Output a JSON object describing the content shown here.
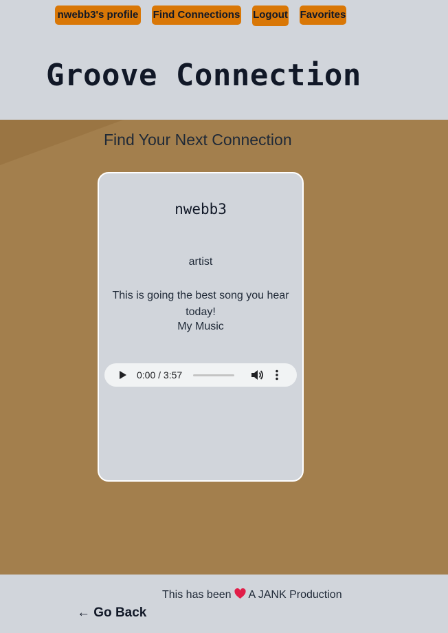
{
  "nav": {
    "profile_label": "nwebb3's profile",
    "find_label": "Find Connections",
    "logout_label": "Logout",
    "favorites_label": "Favorites"
  },
  "header": {
    "title": "Groove Connection"
  },
  "main": {
    "heading": "Find Your Next Connection",
    "card": {
      "username": "nwebb3",
      "role": "artist",
      "description": "This is going the best song you hear today!",
      "music_link": "My Music",
      "player": {
        "time": "0:00 / 3:57",
        "progress": 0,
        "icons": [
          "play-icon",
          "volume-icon",
          "more-options-icon"
        ]
      }
    }
  },
  "footer": {
    "text_before": "This has been",
    "text_after": "A JANK Production",
    "heart_icon": "heart-icon",
    "go_back_label": "← Go Back"
  },
  "colors": {
    "nav_button": "#d97706",
    "page_background": "#d1d5db",
    "main_background": "#a37f4d",
    "card_border": "#ffffff",
    "heart": "#e11d48"
  }
}
